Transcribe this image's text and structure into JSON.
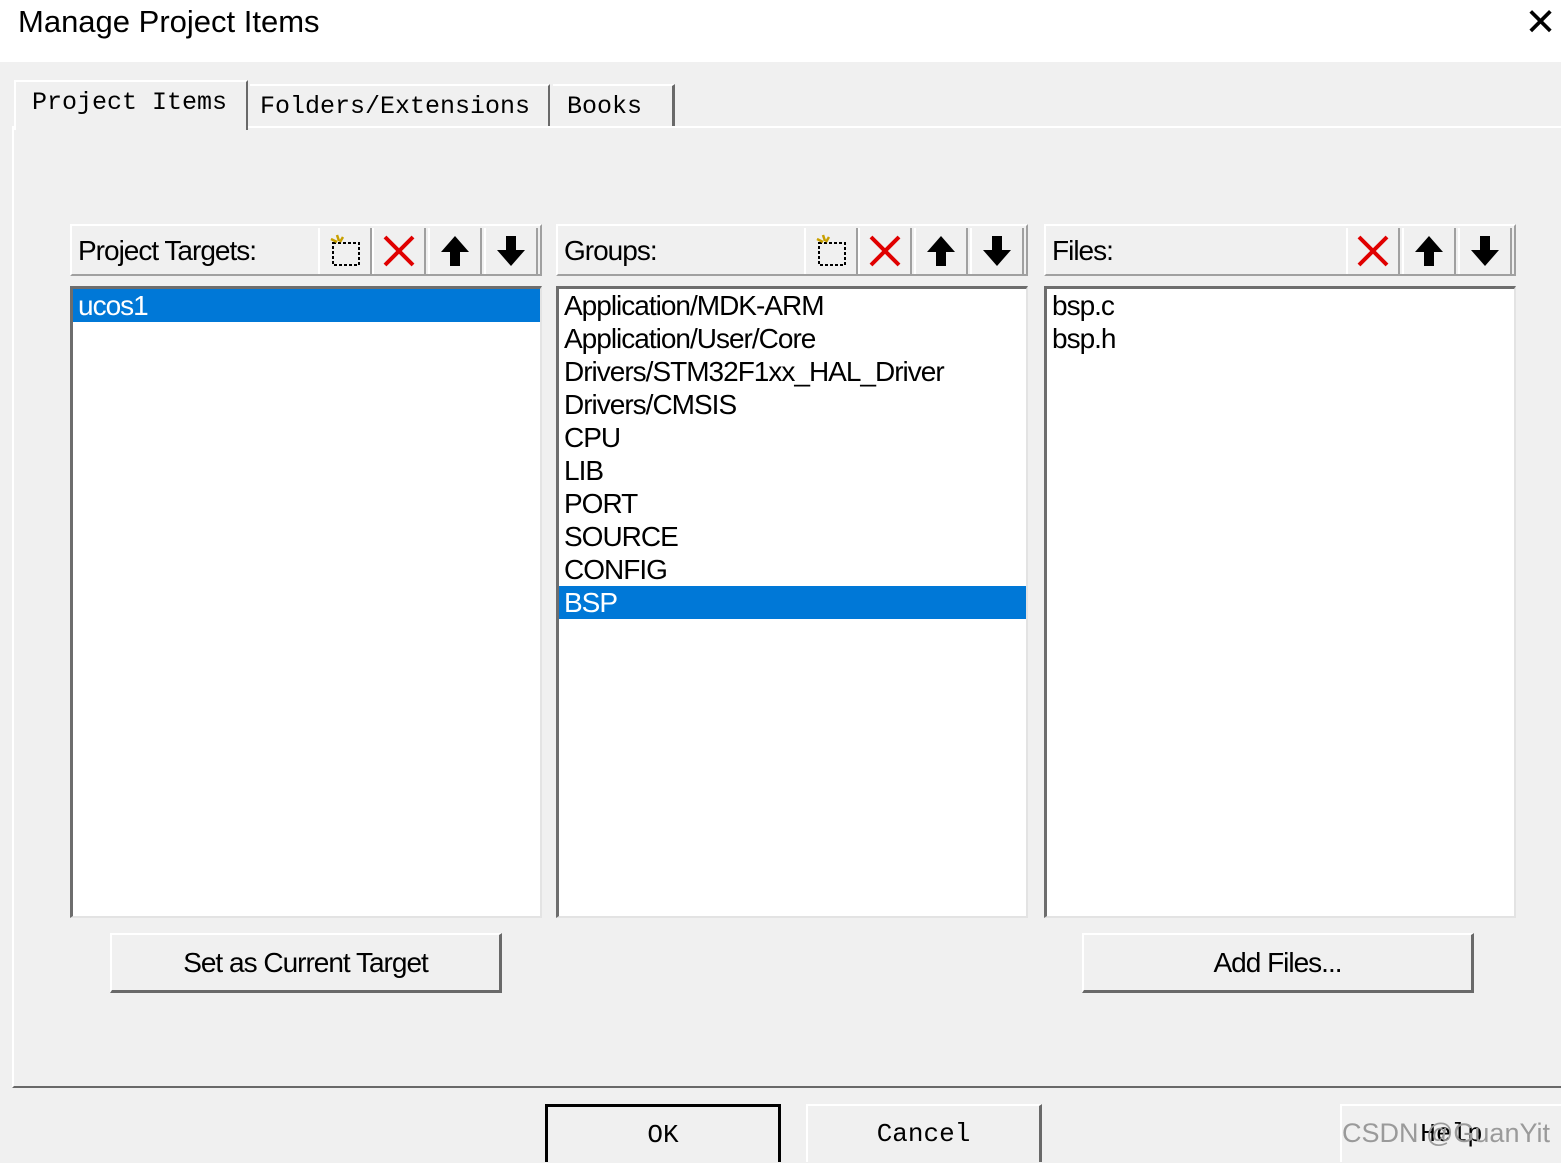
{
  "window": {
    "title": "Manage Project Items",
    "close_glyph": "✕"
  },
  "tabs": [
    {
      "label": "Project Items",
      "selected": true
    },
    {
      "label": "Folders/Extensions",
      "selected": false
    },
    {
      "label": "Books",
      "selected": false
    }
  ],
  "targets": {
    "label": "Project Targets:",
    "toolbar": [
      "new-icon",
      "delete-icon",
      "move-up-icon",
      "move-down-icon"
    ],
    "items": [
      {
        "label": "ucos1",
        "selected": true
      }
    ],
    "action_label": "Set as Current Target"
  },
  "groups": {
    "label": "Groups:",
    "toolbar": [
      "new-icon",
      "delete-icon",
      "move-up-icon",
      "move-down-icon"
    ],
    "items": [
      {
        "label": "Application/MDK-ARM",
        "selected": false
      },
      {
        "label": "Application/User/Core",
        "selected": false
      },
      {
        "label": "Drivers/STM32F1xx_HAL_Driver",
        "selected": false
      },
      {
        "label": "Drivers/CMSIS",
        "selected": false
      },
      {
        "label": "CPU",
        "selected": false
      },
      {
        "label": "LIB",
        "selected": false
      },
      {
        "label": "PORT",
        "selected": false
      },
      {
        "label": "SOURCE",
        "selected": false
      },
      {
        "label": "CONFIG",
        "selected": false
      },
      {
        "label": "BSP",
        "selected": true
      }
    ]
  },
  "files": {
    "label": "Files:",
    "toolbar": [
      "delete-icon",
      "move-up-icon",
      "move-down-icon"
    ],
    "items": [
      {
        "label": "bsp.c",
        "selected": false
      },
      {
        "label": "bsp.h",
        "selected": false
      }
    ],
    "action_label": "Add Files..."
  },
  "footer": {
    "ok_label": "OK",
    "cancel_label": "Cancel",
    "help_label": "Help"
  },
  "watermark": "CSDN @GuanYit",
  "colors": {
    "selection": "#0078d7",
    "delete_red": "#e00000",
    "face": "#f0f0f0"
  }
}
